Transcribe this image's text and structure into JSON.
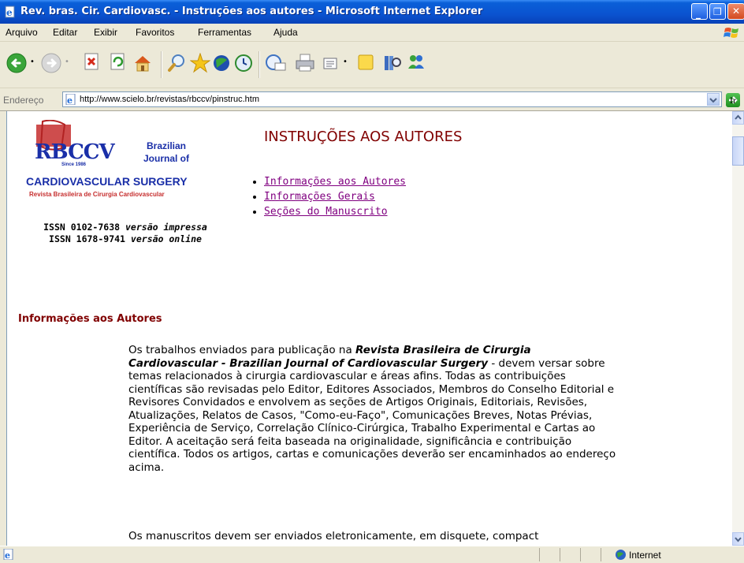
{
  "window": {
    "title": "Rev. bras. Cir. Cardiovasc. - Instruções aos autores - Microsoft Internet Explorer"
  },
  "menu": [
    "Arquivo",
    "Editar",
    "Exibir",
    "Favoritos",
    "Ferramentas",
    "Ajuda"
  ],
  "address": {
    "label": "Endereço",
    "url": "http://www.scielo.br/revistas/rbccv/pinstruc.htm",
    "go_label": "Ir"
  },
  "logo": {
    "abbr": "RBCCV",
    "since": "Since 1986",
    "brazilian": "Brazilian",
    "journal_of": "Journal of",
    "name": "CARDIOVASCULAR SURGERY",
    "subtitle": "Revista Brasileira de Cirurgia Cardiovascular"
  },
  "issn": {
    "print_number": "ISSN 0102-7638",
    "print_label": "versão impressa",
    "online_number": "ISSN 1678-9741",
    "online_label": "versão online"
  },
  "page": {
    "title": "INSTRUÇÕES AOS AUTORES",
    "toc": [
      "Informações aos Autores",
      "Informações Gerais",
      "Seções do Manuscrito"
    ],
    "section_heading": "Informações aos Autores",
    "para1_lead": "Os trabalhos enviados para publicação na ",
    "para1_journal": "Revista Brasileira de Cirurgia Cardiovascular - Brazilian Journal of Cardiovascular Surgery",
    "para1_rest": " - devem versar sobre temas relacionados à cirurgia cardiovascular e áreas afins. Todas as contribuições científicas são revisadas pelo Editor, Editores Associados, Membros do Conselho Editorial e Revisores Convidados e envolvem as seções de Artigos Originais, Editoriais, Revisões, Atualizações, Relatos de Casos, \"Como-eu-Faço\", Comunicações Breves, Notas Prévias, Experiência de Serviço, Correlação Clínico-Cirúrgica, Trabalho Experimental e Cartas ao Editor. A aceitação será feita baseada na originalidade, significância e contribuição científica. Todos os artigos, cartas e comunicações deverão ser encaminhados ao endereço acima.",
    "para2": "Os manuscritos devem ser enviados eletronicamente, em disquete, compact"
  },
  "status": {
    "zone": "Internet"
  },
  "colors": {
    "heading": "#800000",
    "visited_link": "#800080",
    "titlebar": "#0a53d0",
    "logo_blue": "#1a2fa8"
  }
}
